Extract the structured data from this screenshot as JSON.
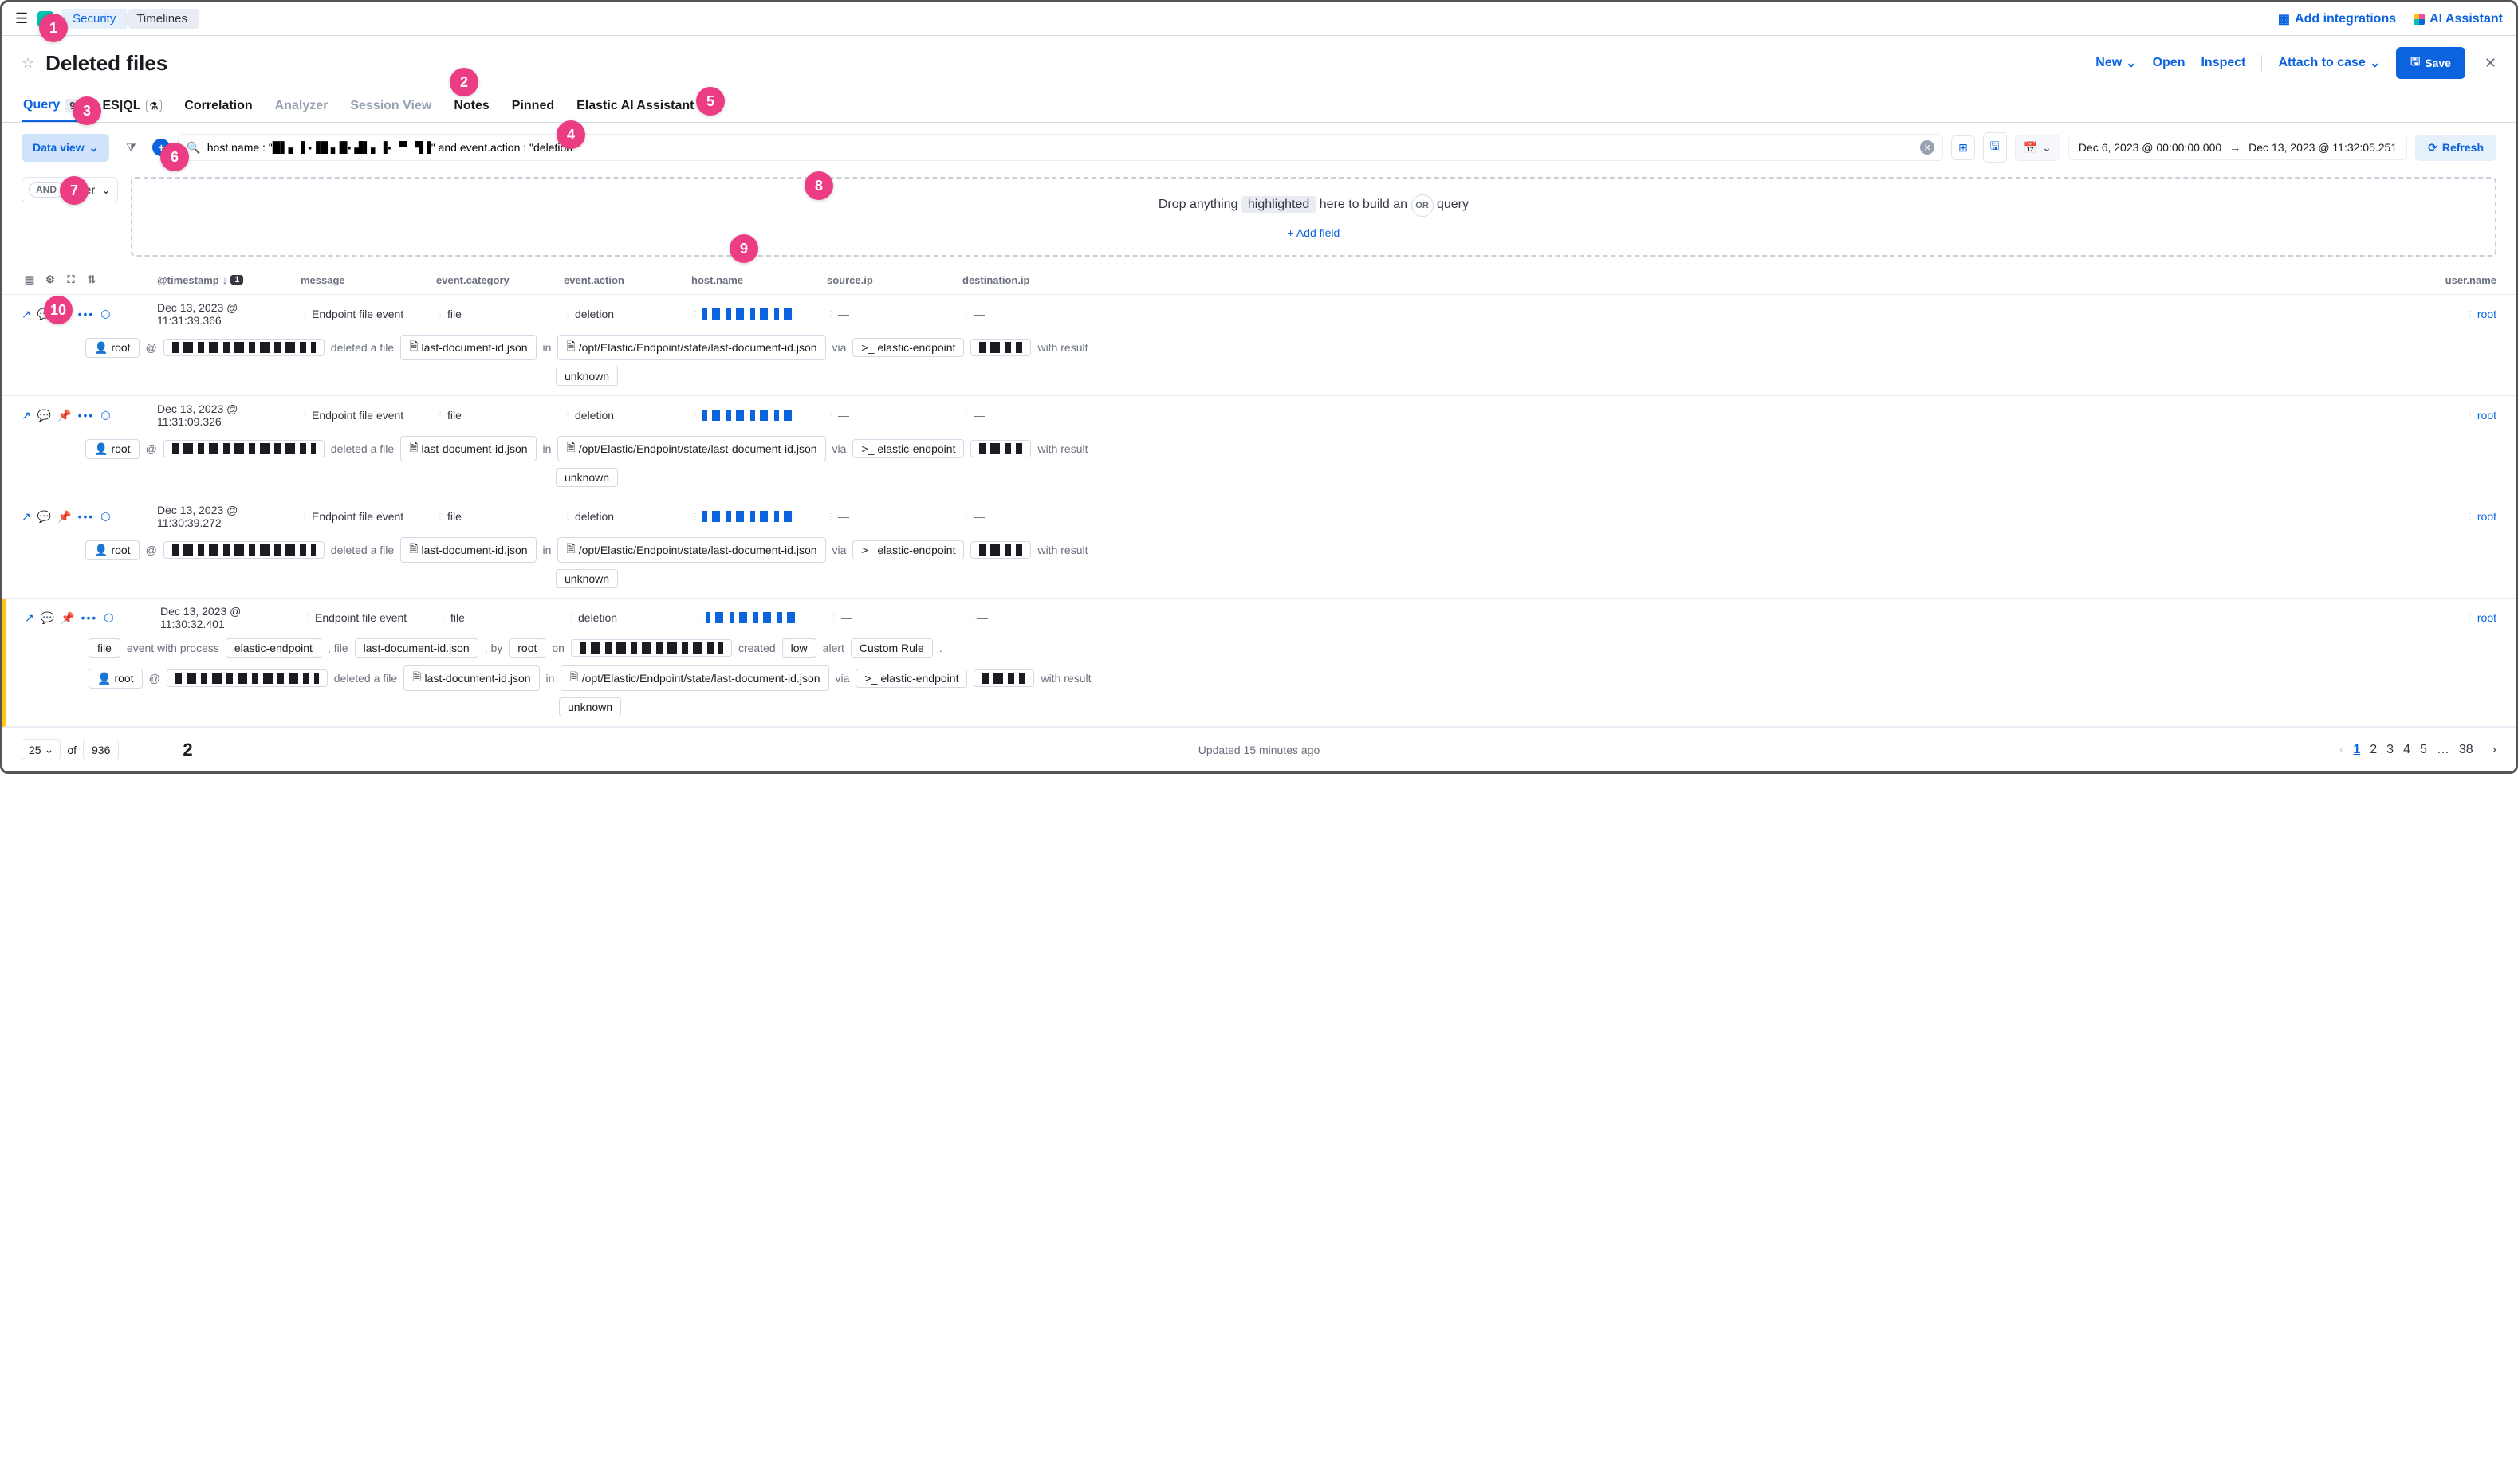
{
  "breadcrumb": {
    "security": "Security",
    "timelines": "Timelines"
  },
  "topbar": {
    "add_integrations": "Add integrations",
    "ai_assistant": "AI Assistant"
  },
  "title": "Deleted files",
  "actions": {
    "new": "New",
    "open": "Open",
    "inspect": "Inspect",
    "attach": "Attach to case",
    "save": "Save"
  },
  "tabs": {
    "query": "Query",
    "query_badge": "9",
    "esql": "ES|QL",
    "correlation": "Correlation",
    "analyzer": "Analyzer",
    "session_view": "Session View",
    "notes": "Notes",
    "pinned": "Pinned",
    "ai": "Elastic AI Assistant"
  },
  "dataview_label": "Data view",
  "query_text": "host.name : \"█▌▖▐ ▪▐█ ▖█▪ ▟▌▖▐▪ ▝▘ ▜▐\" and event.action : \"deletion\"",
  "daterange": {
    "from": "Dec 6, 2023 @ 00:00:00.000",
    "to": "Dec 13, 2023 @ 11:32:05.251"
  },
  "refresh_label": "Refresh",
  "filter": {
    "and": "AND",
    "label": "Filter"
  },
  "dropzone": {
    "pre": "Drop anything",
    "highlighted": "highlighted",
    "mid": "here to build an",
    "or": "OR",
    "post": "query",
    "add_field": "+ Add field"
  },
  "columns": {
    "timestamp": "@timestamp",
    "sort_idx": "1",
    "message": "message",
    "category": "event.category",
    "action": "event.action",
    "host": "host.name",
    "sip": "source.ip",
    "dip": "destination.ip",
    "user": "user.name"
  },
  "rows": [
    {
      "ts": "Dec 13, 2023 @ 11:31:39.366",
      "message": "Endpoint file event",
      "category": "file",
      "action": "deletion",
      "user": "root"
    },
    {
      "ts": "Dec 13, 2023 @ 11:31:09.326",
      "message": "Endpoint file event",
      "category": "file",
      "action": "deletion",
      "user": "root"
    },
    {
      "ts": "Dec 13, 2023 @ 11:30:39.272",
      "message": "Endpoint file event",
      "category": "file",
      "action": "deletion",
      "user": "root"
    },
    {
      "ts": "Dec 13, 2023 @ 11:30:32.401",
      "message": "Endpoint file event",
      "category": "file",
      "action": "deletion",
      "user": "root"
    }
  ],
  "detail": {
    "user": "root",
    "at": "@",
    "deleted": "deleted a file",
    "file": "last-document-id.json",
    "in": "in",
    "path": "/opt/Elastic/Endpoint/state/last-document-id.json",
    "via": "via",
    "proc": "elastic-endpoint",
    "with_result": "with result",
    "unknown": "unknown"
  },
  "alert_detail": {
    "file": "file",
    "event_with_process": "event with process",
    "process": "elastic-endpoint",
    "comma_file": ", file",
    "filename": "last-document-id.json",
    "by": ", by",
    "user": "root",
    "on": "on",
    "created": "created",
    "low": "low",
    "alert": "alert",
    "rule": "Custom Rule",
    "dot": "."
  },
  "footer": {
    "page_size": "25",
    "of": "of",
    "total": "936",
    "updated": "Updated 15 minutes ago",
    "footnote": "2",
    "pages": [
      "1",
      "2",
      "3",
      "4",
      "5",
      "…",
      "38"
    ]
  },
  "callouts": {
    "1": "1",
    "2": "2",
    "3": "3",
    "4": "4",
    "5": "5",
    "6": "6",
    "7": "7",
    "8": "8",
    "9": "9",
    "10": "10"
  }
}
